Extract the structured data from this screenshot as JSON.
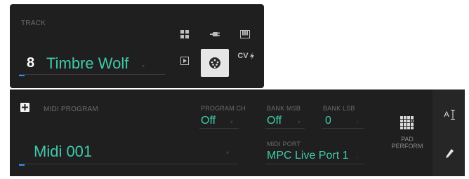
{
  "track": {
    "label": "TRACK",
    "number": "8",
    "name": "Timbre Wolf"
  },
  "track_types": {
    "cv_label": "CV"
  },
  "midi": {
    "program_label": "MIDI PROGRAM",
    "program_name": "Midi 001",
    "program_ch_label": "PROGRAM CH",
    "program_ch_value": "Off",
    "bank_msb_label": "BANK MSB",
    "bank_msb_value": "Off",
    "bank_lsb_label": "BANK LSB",
    "bank_lsb_value": "0",
    "midi_port_label": "MIDI PORT",
    "midi_port_value": "MPC Live Port 1"
  },
  "pad_perform": {
    "line1": "PAD",
    "line2": "PERFORM"
  },
  "side_buttons": {
    "text_size_label": "A"
  },
  "colors": {
    "accent_teal": "#41c9a8",
    "accent_blue": "#2d8cff",
    "panel_bg": "#1f1f1f"
  }
}
